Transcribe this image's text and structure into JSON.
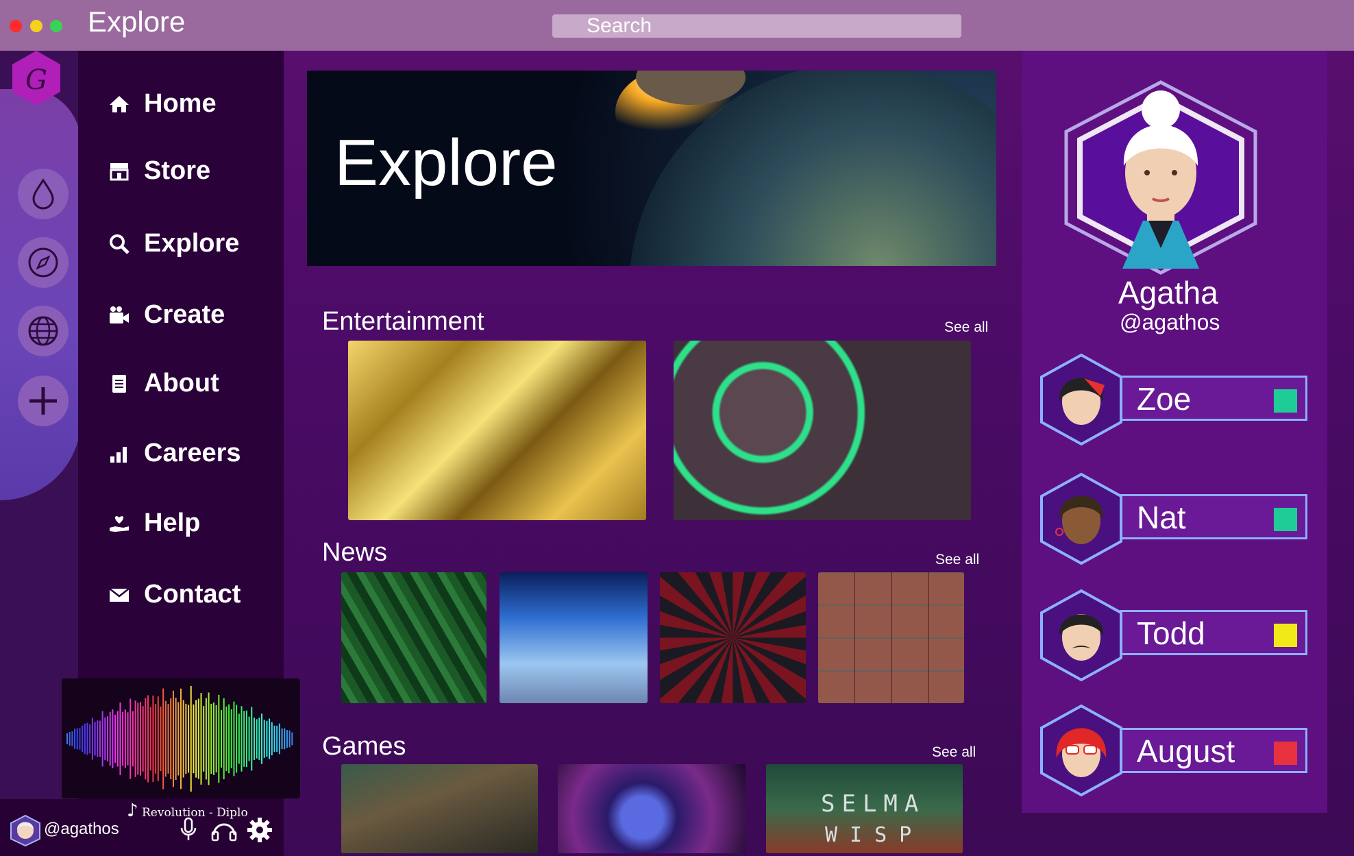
{
  "window": {
    "title": "Explore",
    "traffic_lights": [
      "#ff2a2a",
      "#f2d21b",
      "#39d353"
    ]
  },
  "search": {
    "placeholder": "Search"
  },
  "rail": {
    "logo_icon": "script-g-hexagon-icon",
    "buttons": [
      "drop-icon",
      "compass-icon",
      "globe-icon",
      "plus-icon"
    ]
  },
  "nav": {
    "items": [
      {
        "label": "Home",
        "icon": "home-icon"
      },
      {
        "label": "Store",
        "icon": "store-icon"
      },
      {
        "label": "Explore",
        "icon": "search-icon"
      },
      {
        "label": "Create",
        "icon": "camera-icon"
      },
      {
        "label": "About",
        "icon": "document-icon"
      },
      {
        "label": "Careers",
        "icon": "chart-icon"
      },
      {
        "label": "Help",
        "icon": "heart-hand-icon"
      },
      {
        "label": "Contact",
        "icon": "mail-icon"
      }
    ]
  },
  "player": {
    "track": "Revolution - Diplo",
    "user_handle": "@agathos"
  },
  "hero": {
    "title": "Explore"
  },
  "sections": {
    "entertainment": {
      "title": "Entertainment",
      "see_all": "See all"
    },
    "news": {
      "title": "News",
      "see_all": "See all"
    },
    "games": {
      "title": "Games",
      "see_all": "See all",
      "tile3_text_1": "SELMA",
      "tile3_text_2": "WISP"
    }
  },
  "profile": {
    "name": "Agatha",
    "handle": "@agathos"
  },
  "friends": [
    {
      "name": "Zoe",
      "status_color": "#1fcc97"
    },
    {
      "name": "Nat",
      "status_color": "#1fcc97"
    },
    {
      "name": "Todd",
      "status_color": "#f2ea18"
    },
    {
      "name": "August",
      "status_color": "#e8313f"
    }
  ]
}
